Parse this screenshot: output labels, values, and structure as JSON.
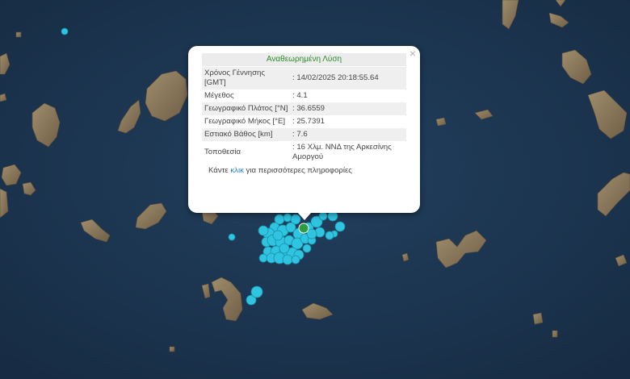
{
  "popup": {
    "title": "Αναθεωρημένη Λύση",
    "close": "×",
    "rows": [
      {
        "label": "Χρόνος Γέννησης [GMT]",
        "value": ": 14/02/2025 20:18:55.64"
      },
      {
        "label": "Μέγεθος",
        "value": ": 4.1"
      },
      {
        "label": "Γεωγραφικό Πλάτος [°N]",
        "value": ": 36.6559"
      },
      {
        "label": "Γεωγραφικό Μήκος [°E]",
        "value": ": 25.7391"
      },
      {
        "label": "Εστιακό Βάθος [km]",
        "value": ": 7.6"
      },
      {
        "label": "Τοποθεσία",
        "value": ": 16 Χλμ. ΝΝΔ της Αρκεσίνης Αμοργού"
      }
    ],
    "more_prefix": "Κάντε ",
    "more_link": "κλικ",
    "more_suffix": " για περισσότερες πληροφορίες"
  },
  "colors": {
    "sea": "#1c3550",
    "land": "#8c7a5e",
    "event_marker": "#2fc4e0",
    "selected_marker": "#2e9a44",
    "popup_title": "#2e8b2e",
    "link": "#1e7fd0"
  },
  "map": {
    "basemap": "satellite imagery (Aegean Sea, Cyclades)",
    "event_icon": "earthquake-marker-circle",
    "selected_icon": "selected-event-marker"
  }
}
